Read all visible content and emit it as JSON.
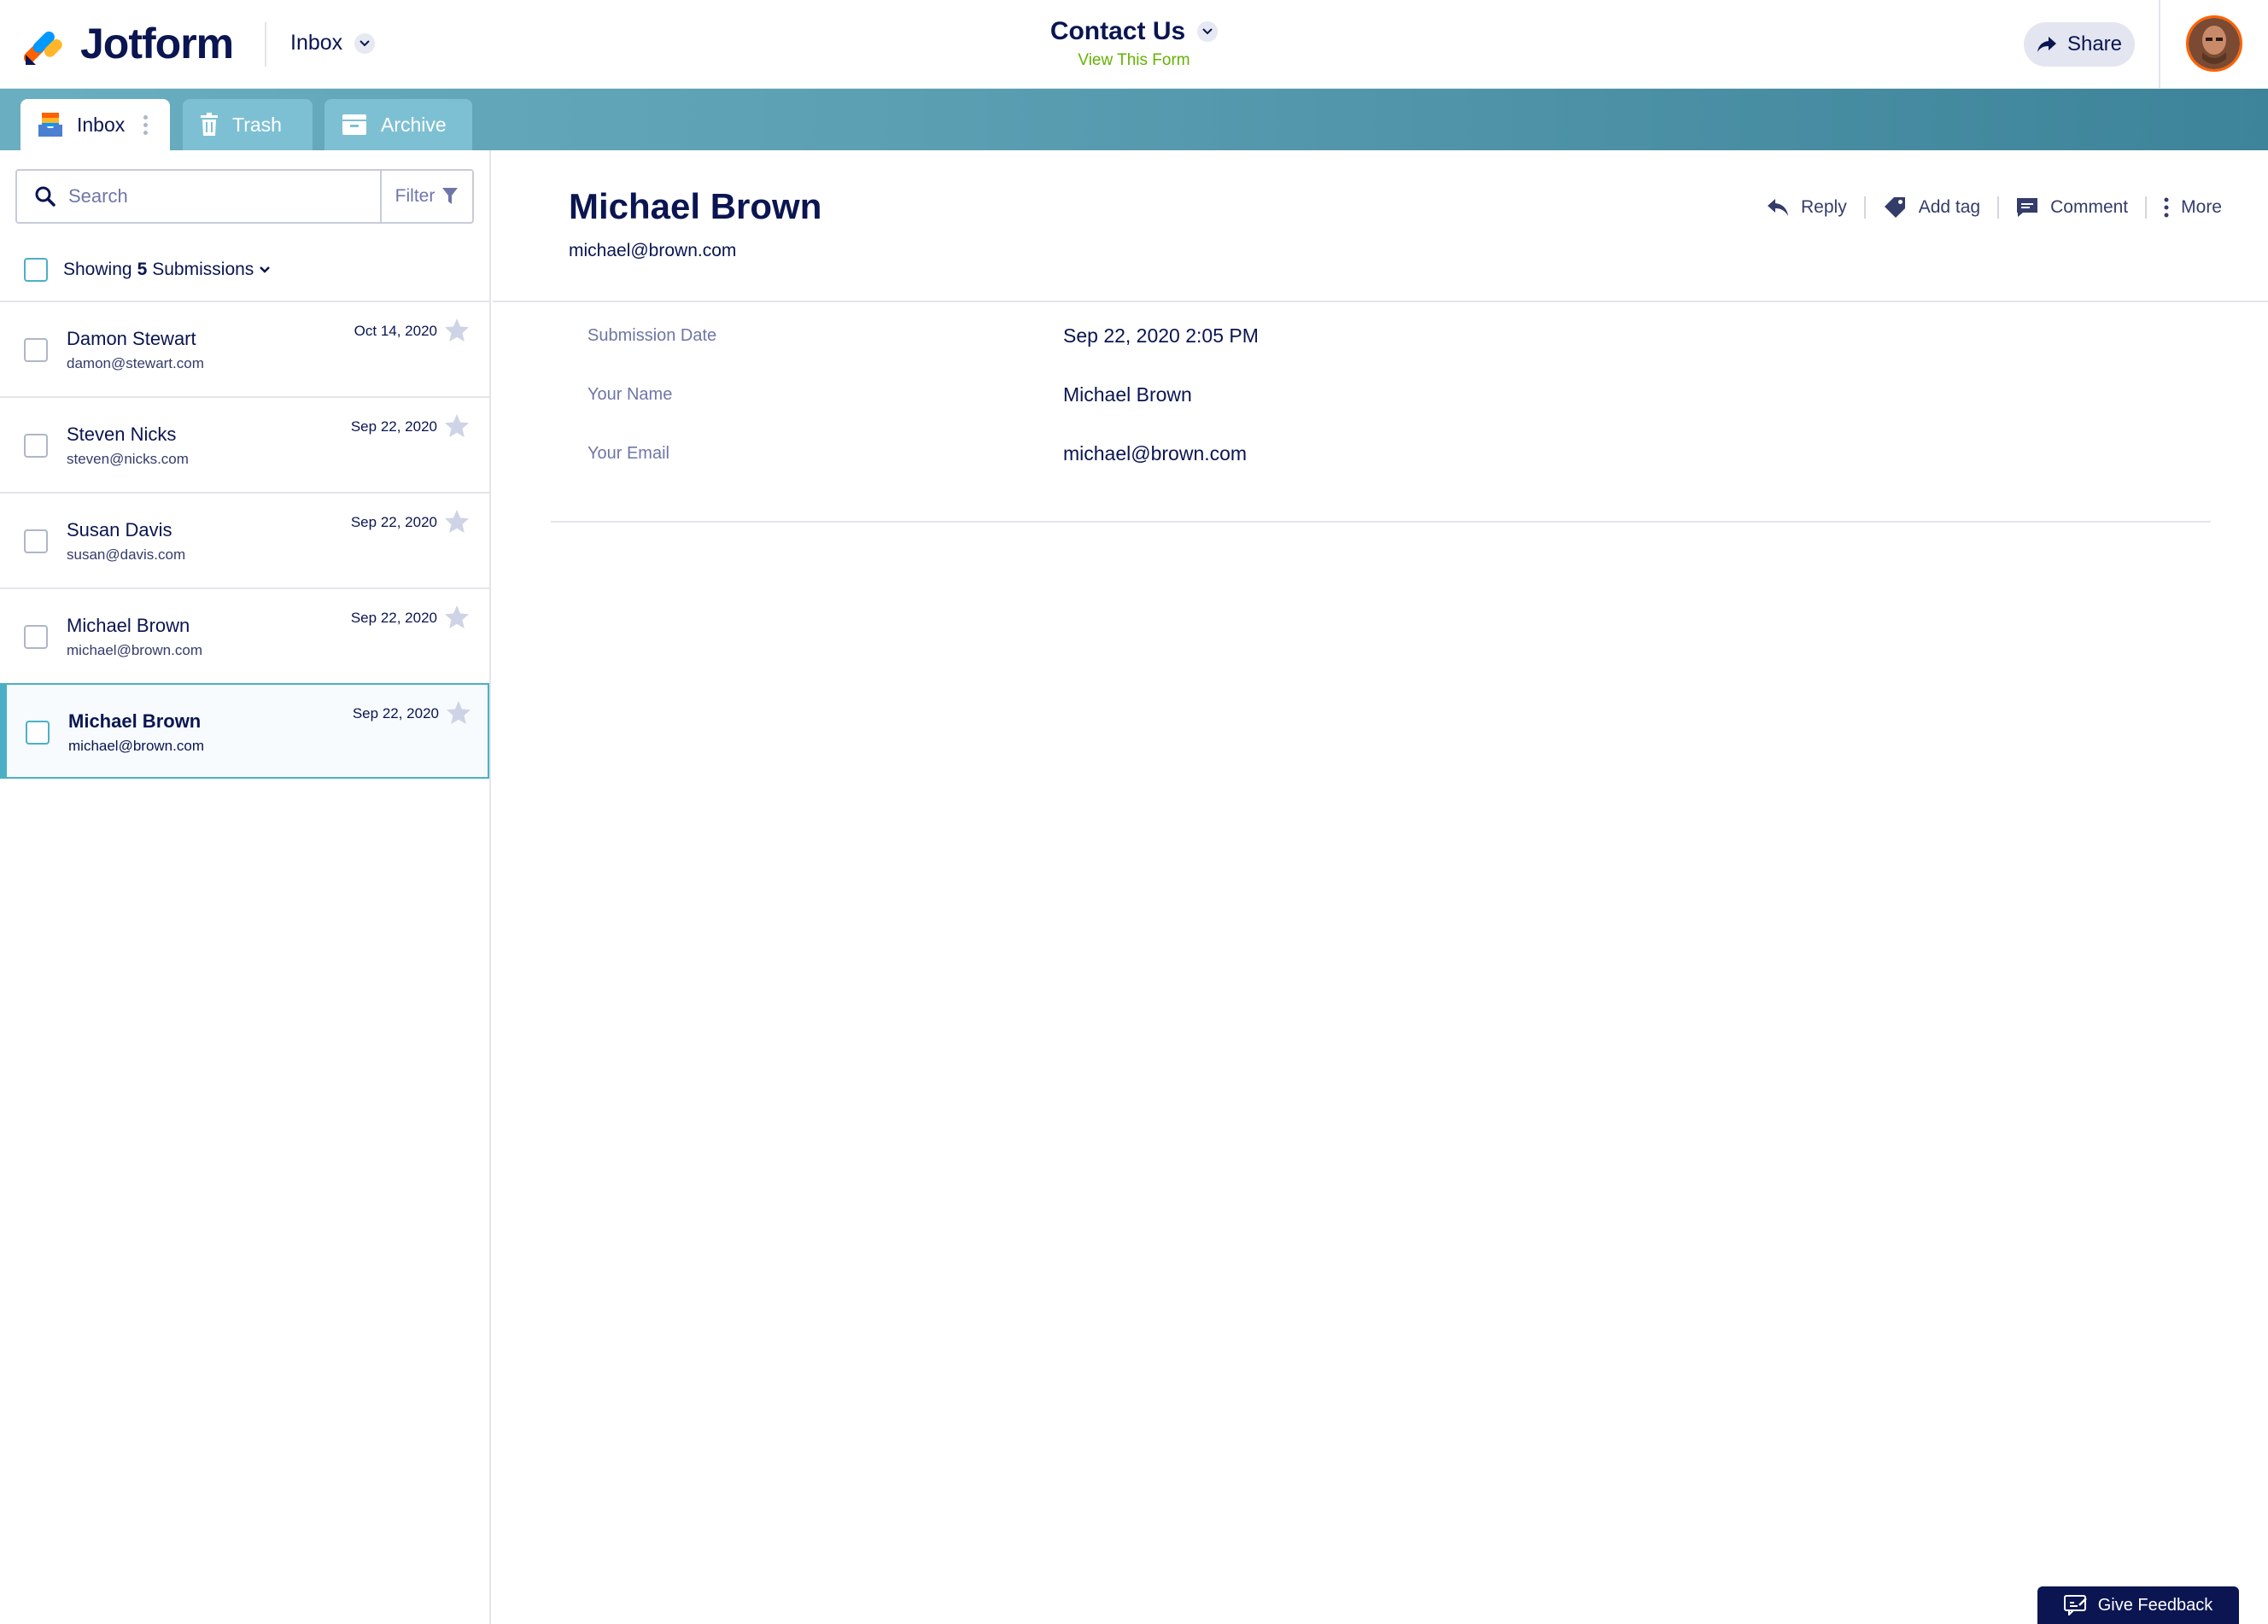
{
  "header": {
    "brand": "Jotform",
    "inbox_dropdown": "Inbox",
    "form_title": "Contact Us",
    "view_form_link": "View This Form",
    "share_label": "Share"
  },
  "tabs": [
    {
      "label": "Inbox",
      "icon": "inbox-icon",
      "active": true
    },
    {
      "label": "Trash",
      "icon": "trash-icon",
      "active": false
    },
    {
      "label": "Archive",
      "icon": "archive-icon",
      "active": false
    }
  ],
  "search": {
    "placeholder": "Search",
    "filter_label": "Filter"
  },
  "showing": {
    "prefix": "Showing",
    "count": "5",
    "suffix": "Submissions"
  },
  "submissions": [
    {
      "name": "Damon Stewart",
      "email": "damon@stewart.com",
      "date": "Oct 14, 2020",
      "selected": false
    },
    {
      "name": "Steven Nicks",
      "email": "steven@nicks.com",
      "date": "Sep 22, 2020",
      "selected": false
    },
    {
      "name": "Susan Davis",
      "email": "susan@davis.com",
      "date": "Sep 22, 2020",
      "selected": false
    },
    {
      "name": "Michael Brown",
      "email": "michael@brown.com",
      "date": "Sep 22, 2020",
      "selected": false
    },
    {
      "name": "Michael Brown",
      "email": "michael@brown.com",
      "date": "Sep 22, 2020",
      "selected": true
    }
  ],
  "detail": {
    "name": "Michael Brown",
    "email": "michael@brown.com",
    "actions": {
      "reply": "Reply",
      "add_tag": "Add tag",
      "comment": "Comment",
      "more": "More"
    },
    "fields": [
      {
        "label": "Submission Date",
        "value": "Sep 22, 2020 2:05 PM"
      },
      {
        "label": "Your Name",
        "value": "Michael  Brown"
      },
      {
        "label": "Your Email",
        "value": "michael@brown.com"
      }
    ]
  },
  "feedback_label": "Give Feedback",
  "colors": {
    "navy": "#0a1551",
    "teal": "#4bb0c6",
    "green_link": "#64b200",
    "orange_accent": "#ff6100"
  }
}
